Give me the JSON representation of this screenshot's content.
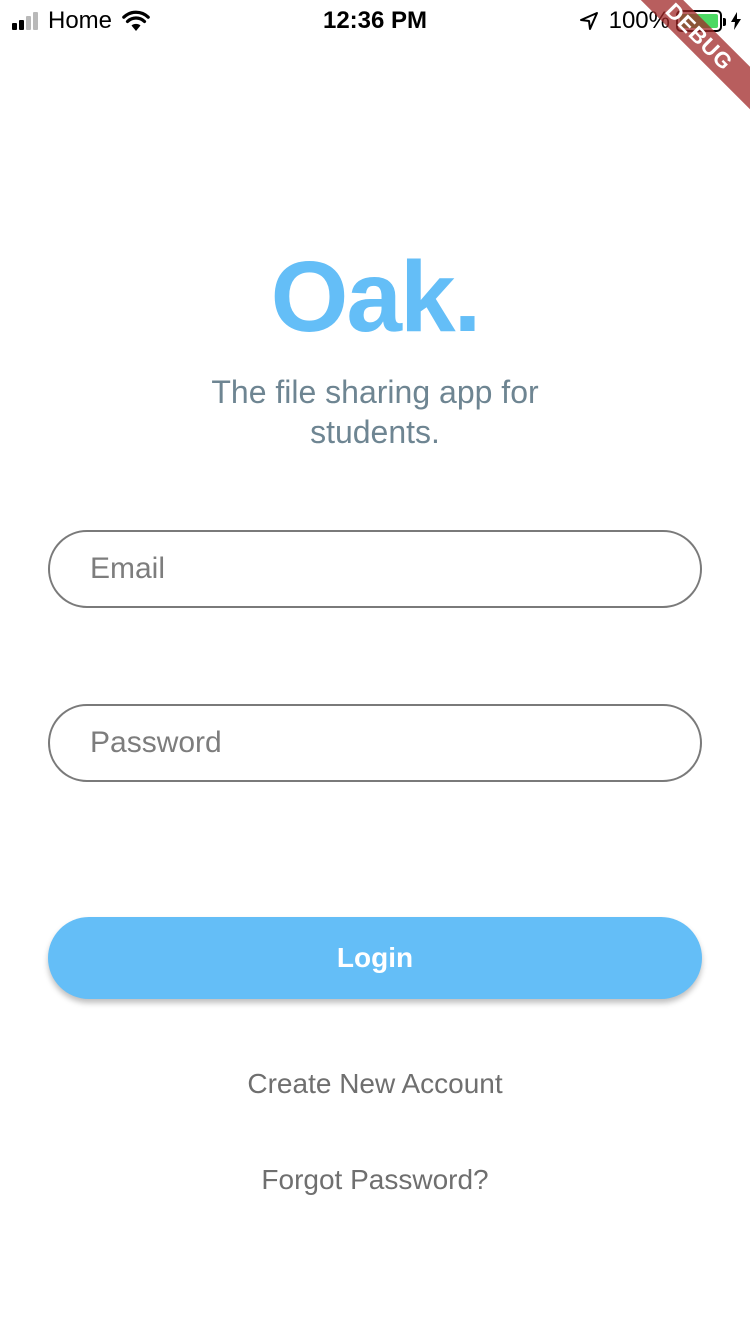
{
  "status_bar": {
    "carrier": "Home",
    "time": "12:36 PM",
    "battery_percent": "100%",
    "battery_level": 1.0,
    "battery_color": "#4cd964"
  },
  "debug_banner": {
    "label": "DEBUG"
  },
  "brand": {
    "logo_text": "Oak.",
    "tagline": "The file sharing app for students.",
    "accent_color": "#64bef7"
  },
  "form": {
    "email": {
      "value": "",
      "placeholder": "Email"
    },
    "password": {
      "value": "",
      "placeholder": "Password"
    },
    "login_label": "Login"
  },
  "links": {
    "create_account": "Create New Account",
    "forgot_password": "Forgot Password?"
  },
  "icons": {
    "signal": "cellular-signal-icon",
    "wifi": "wifi-icon",
    "location": "location-arrow-icon",
    "battery": "battery-icon",
    "charging": "charging-bolt-icon"
  }
}
